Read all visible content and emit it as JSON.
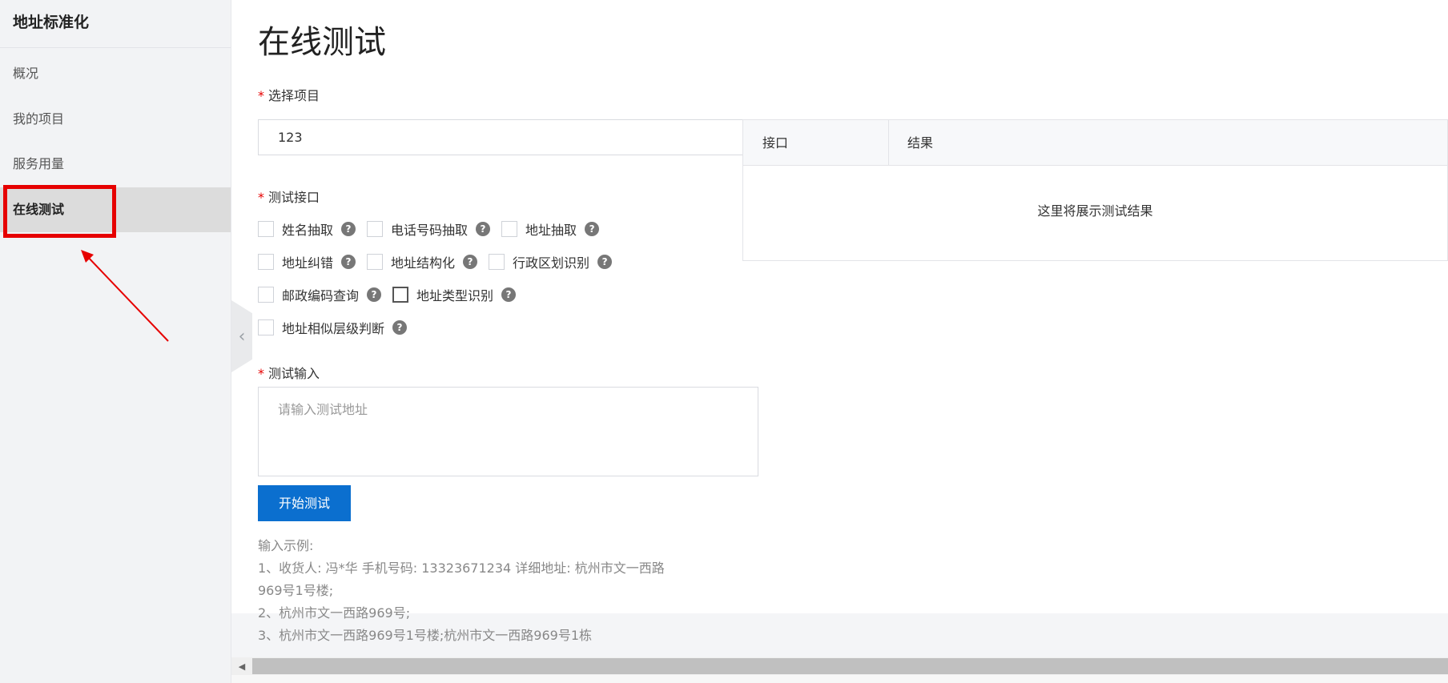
{
  "sidebar": {
    "title": "地址标准化",
    "items": [
      {
        "label": "概况"
      },
      {
        "label": "我的项目"
      },
      {
        "label": "服务用量"
      },
      {
        "label": "在线测试",
        "active": true
      }
    ]
  },
  "main": {
    "title": "在线测试",
    "project": {
      "label": "选择项目",
      "value": "123"
    },
    "api": {
      "label": "测试接口",
      "options": [
        {
          "label": "姓名抽取"
        },
        {
          "label": "电话号码抽取"
        },
        {
          "label": "地址抽取"
        },
        {
          "label": "地址纠错"
        },
        {
          "label": "地址结构化"
        },
        {
          "label": "行政区划识别"
        },
        {
          "label": "邮政编码查询"
        },
        {
          "label": "地址类型识别"
        },
        {
          "label": "地址相似层级判断"
        }
      ]
    },
    "input": {
      "label": "测试输入",
      "placeholder": "请输入测试地址"
    },
    "start_button": "开始测试",
    "examples": {
      "title": "输入示例:",
      "lines": [
        "1、收货人: 冯*华 手机号码: 13323671234 详细地址: 杭州市文一西路",
        "969号1号楼;",
        "2、杭州市文一西路969号;",
        "3、杭州市文一西路969号1号楼;杭州市文一西路969号1栋"
      ]
    }
  },
  "results": {
    "col_api": "接口",
    "col_result": "结果",
    "empty_text": "这里将展示测试结果"
  },
  "colors": {
    "accent": "#0b6fcf",
    "required": "#e60000",
    "highlight": "#e60000"
  },
  "icons": {
    "help": "question-circle-icon",
    "collapse": "chevron-left-icon",
    "select": "chevron-down-icon",
    "scroll_left": "triangle-left-icon"
  }
}
